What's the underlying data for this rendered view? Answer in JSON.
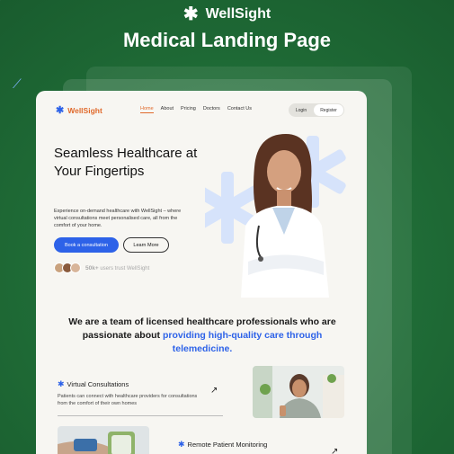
{
  "brand": {
    "name": "WellSight",
    "icon": "asterisk-star-icon"
  },
  "headline": "Medical Landing Page",
  "card": {
    "logo": "WellSight",
    "nav": [
      "Home",
      "About",
      "Pricing",
      "Doctors",
      "Contact Us"
    ],
    "login": "Login",
    "register": "Register",
    "hero_title": "Seamless Healthcare at Your Fingertips",
    "hero_desc": "Experience on-demand healthcare with WellSight – where virtual consultations meet personalised care, all from the comfort of your home.",
    "btn_primary": "Book a consultation",
    "btn_secondary": "Learn More",
    "social_count": "50k+",
    "social_text": "users trust WellSight",
    "team_pre": "We are a team of licensed healthcare professionals who are passionate about",
    "team_highlight": "providing high-quality care through telemedicine.",
    "svc1_title": "Virtual Consultations",
    "svc1_desc": "Patients can connect with healthcare providers for consultations from the comfort of their own homes",
    "svc2_title": "Remote Patient Monitoring"
  },
  "colors": {
    "bg": "#1f6b36",
    "accent": "#2d62e8",
    "logo": "#e06a2c",
    "card": "#f7f6f2"
  }
}
